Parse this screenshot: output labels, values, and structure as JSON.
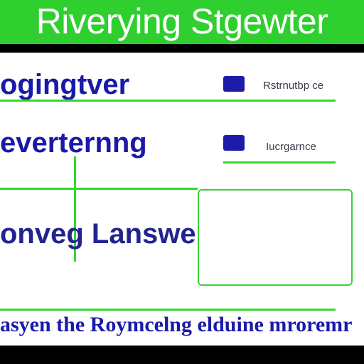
{
  "header": {
    "title": "Riverying Stgewter"
  },
  "rows": [
    {
      "label": "ogingtver",
      "value": "Rstrnutbp ce"
    },
    {
      "label": "everternng",
      "value": "Iucrgarnce"
    }
  ],
  "panel": {
    "label": "onveg Lanswer"
  },
  "footer": {
    "text": "asyen the Roymcelng elduine mroremr"
  },
  "colors": {
    "accent": "#2fcf2f",
    "primary": "#1a1aa8"
  }
}
